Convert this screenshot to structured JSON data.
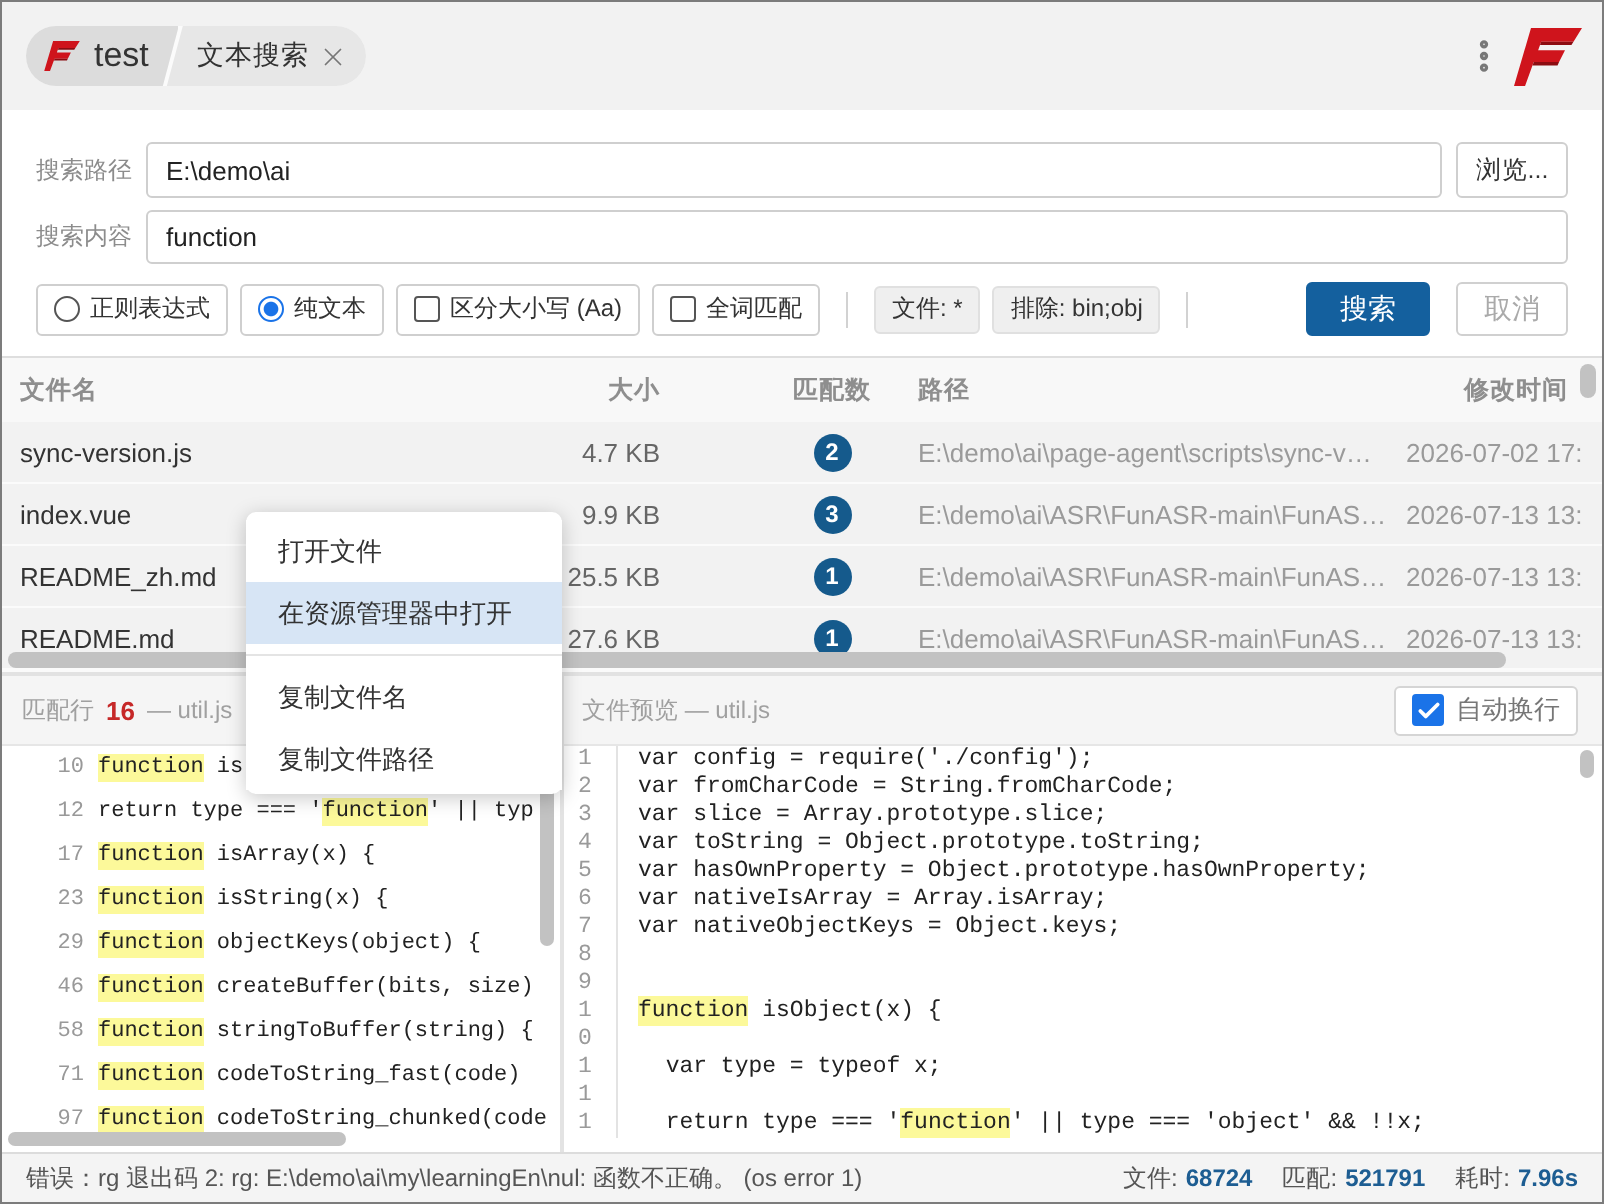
{
  "tabs": [
    {
      "kind": "app",
      "label": "test"
    },
    {
      "kind": "page",
      "label": "文本搜索"
    }
  ],
  "search": {
    "path_label": "搜索路径",
    "path_value": "E:\\demo\\ai",
    "browse_button": "浏览...",
    "content_label": "搜索内容",
    "content_value": "function"
  },
  "modes": [
    {
      "label": "正则表达式",
      "selected": false
    },
    {
      "label": "纯文本",
      "selected": true
    }
  ],
  "flags": [
    {
      "label": "区分大小写 (Aa)",
      "checked": false
    },
    {
      "label": "全词匹配",
      "checked": false
    }
  ],
  "filters": [
    "文件: *",
    "排除: bin;obj"
  ],
  "actions": [
    {
      "kind": "primary",
      "label": "搜索",
      "disabled": false
    },
    {
      "kind": "secondary",
      "label": "取消",
      "disabled": true
    }
  ],
  "results": {
    "columns": [
      "文件名",
      "大小",
      "匹配数",
      "路径",
      "修改时间"
    ],
    "rows": [
      {
        "name": "sync-version.js",
        "size": "4.7 KB",
        "matches": "2",
        "path": "E:\\demo\\ai\\page-agent\\scripts\\sync-v…",
        "modified": "2026-07-02 17:"
      },
      {
        "name": "index.vue",
        "size": "9.9 KB",
        "matches": "3",
        "path": "E:\\demo\\ai\\ASR\\FunASR-main\\FunAS…",
        "modified": "2026-07-13 13:"
      },
      {
        "name": "README_zh.md",
        "size": "25.5 KB",
        "matches": "1",
        "path": "E:\\demo\\ai\\ASR\\FunASR-main\\FunAS…",
        "modified": "2026-07-13 13:"
      },
      {
        "name": "README.md",
        "size": "27.6 KB",
        "matches": "1",
        "path": "E:\\demo\\ai\\ASR\\FunASR-main\\FunAS…",
        "modified": "2026-07-13 13:"
      }
    ]
  },
  "context_menu": {
    "items": [
      {
        "kind": "item",
        "label": "打开文件",
        "selected": false
      },
      {
        "kind": "item",
        "label": "在资源管理器中打开",
        "selected": true
      },
      {
        "kind": "separator"
      },
      {
        "kind": "item",
        "label": "复制文件名",
        "selected": false
      },
      {
        "kind": "item",
        "label": "复制文件路径",
        "selected": false
      }
    ]
  },
  "matches_pane": {
    "title": "匹配行",
    "count": "16",
    "file": "— util.js",
    "lines": [
      {
        "number": "10",
        "segments": [
          {
            "text": "function",
            "highlight": true
          },
          {
            "text": " is",
            "highlight": false
          }
        ]
      },
      {
        "number": "12",
        "segments": [
          {
            "text": "return type === '",
            "highlight": false
          },
          {
            "text": "function",
            "highlight": true
          },
          {
            "text": "' || typ",
            "highlight": false
          }
        ]
      },
      {
        "number": "17",
        "segments": [
          {
            "text": "function",
            "highlight": true
          },
          {
            "text": " isArray(x) {",
            "highlight": false
          }
        ]
      },
      {
        "number": "23",
        "segments": [
          {
            "text": "function",
            "highlight": true
          },
          {
            "text": " isString(x) {",
            "highlight": false
          }
        ]
      },
      {
        "number": "29",
        "segments": [
          {
            "text": "function",
            "highlight": true
          },
          {
            "text": " objectKeys(object) {",
            "highlight": false
          }
        ]
      },
      {
        "number": "46",
        "segments": [
          {
            "text": "function",
            "highlight": true
          },
          {
            "text": " createBuffer(bits, size)",
            "highlight": false
          }
        ]
      },
      {
        "number": "58",
        "segments": [
          {
            "text": "function",
            "highlight": true
          },
          {
            "text": " stringToBuffer(string) {",
            "highlight": false
          }
        ]
      },
      {
        "number": "71",
        "segments": [
          {
            "text": "function",
            "highlight": true
          },
          {
            "text": " codeToString_fast(code)",
            "highlight": false
          }
        ]
      },
      {
        "number": "97",
        "segments": [
          {
            "text": "function",
            "highlight": true
          },
          {
            "text": " codeToString_chunked(code",
            "highlight": false
          }
        ]
      }
    ]
  },
  "preview": {
    "title": "文件预览 — util.js",
    "wrap": {
      "label": "自动换行",
      "checked": true
    },
    "lines": [
      {
        "number": "1",
        "segments": [
          {
            "text": "var config = require('./config');",
            "highlight": false
          }
        ]
      },
      {
        "number": "2",
        "segments": [
          {
            "text": "var fromCharCode = String.fromCharCode;",
            "highlight": false
          }
        ]
      },
      {
        "number": "3",
        "segments": [
          {
            "text": "var slice = Array.prototype.slice;",
            "highlight": false
          }
        ]
      },
      {
        "number": "4",
        "segments": [
          {
            "text": "var toString = Object.prototype.toString;",
            "highlight": false
          }
        ]
      },
      {
        "number": "5",
        "segments": [
          {
            "text": "var hasOwnProperty = Object.prototype.hasOwnProperty;",
            "highlight": false
          }
        ]
      },
      {
        "number": "6",
        "segments": [
          {
            "text": "var nativeIsArray = Array.isArray;",
            "highlight": false
          }
        ]
      },
      {
        "number": "7",
        "segments": [
          {
            "text": "var nativeObjectKeys = Object.keys;",
            "highlight": false
          }
        ]
      },
      {
        "number": "8"
      },
      {
        "number": "9"
      },
      {
        "number": "10",
        "segments": [
          {
            "text": "function",
            "highlight": true
          },
          {
            "text": " isObject(x) {",
            "highlight": false
          }
        ]
      },
      {
        "number": "11",
        "segments": [
          {
            "text": "  var type = typeof x;",
            "highlight": false
          }
        ]
      },
      {
        "number": "1",
        "segments": [
          {
            "text": "  return type === '",
            "highlight": false
          },
          {
            "text": "function",
            "highlight": true
          },
          {
            "text": "' || type === 'object' && !!x;",
            "highlight": false
          }
        ]
      }
    ]
  },
  "status_bar": {
    "message": "错误：rg 退出码 2: rg: E:\\demo\\ai\\my\\learningEn\\nul: 函数不正确。 (os error 1)",
    "stats": [
      {
        "label": "文件:",
        "value": "68724"
      },
      {
        "label": "匹配:",
        "value": "521791"
      },
      {
        "label": "耗时:",
        "value": "7.96s"
      }
    ]
  }
}
